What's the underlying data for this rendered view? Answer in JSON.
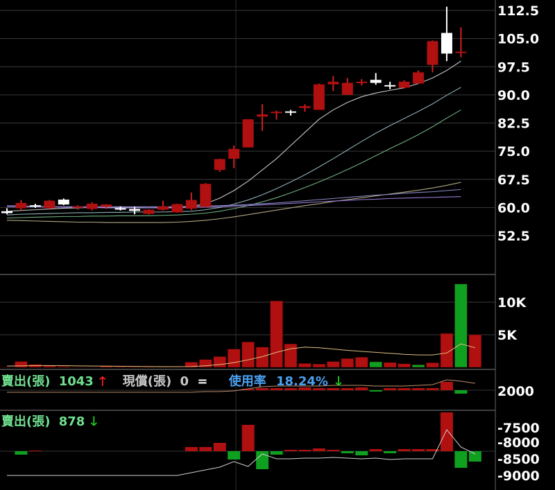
{
  "chart_data": [
    {
      "type": "candlestick",
      "panel": "price",
      "y_ticks": [
        "112.5",
        "105.0",
        "97.5",
        "90.0",
        "82.5",
        "75.0",
        "67.5",
        "60.0",
        "52.5"
      ],
      "ylim": [
        45,
        115
      ],
      "candles": [
        {
          "o": 59.0,
          "h": 59.8,
          "l": 58.2,
          "c": 58.5
        },
        {
          "o": 59.8,
          "h": 62.0,
          "l": 59.2,
          "c": 61.2
        },
        {
          "o": 60.6,
          "h": 61.0,
          "l": 59.9,
          "c": 60.4
        },
        {
          "o": 59.8,
          "h": 62.0,
          "l": 59.6,
          "c": 61.8
        },
        {
          "o": 62.1,
          "h": 62.4,
          "l": 60.6,
          "c": 60.8
        },
        {
          "o": 60.2,
          "h": 60.6,
          "l": 59.4,
          "c": 60.3
        },
        {
          "o": 59.6,
          "h": 61.4,
          "l": 59.2,
          "c": 61.0
        },
        {
          "o": 60.2,
          "h": 60.9,
          "l": 59.6,
          "c": 60.8
        },
        {
          "o": 59.8,
          "h": 60.3,
          "l": 59.2,
          "c": 59.5
        },
        {
          "o": 59.6,
          "h": 60.2,
          "l": 58.2,
          "c": 59.1
        },
        {
          "o": 58.3,
          "h": 59.5,
          "l": 58.1,
          "c": 59.4
        },
        {
          "o": 59.4,
          "h": 61.8,
          "l": 59.2,
          "c": 60.3
        },
        {
          "o": 58.7,
          "h": 61.0,
          "l": 58.6,
          "c": 60.9
        },
        {
          "o": 59.7,
          "h": 64.0,
          "l": 59.3,
          "c": 62.0
        },
        {
          "o": 60.2,
          "h": 66.5,
          "l": 60.0,
          "c": 66.3
        },
        {
          "o": 70.0,
          "h": 73.0,
          "l": 69.5,
          "c": 72.9
        },
        {
          "o": 73.0,
          "h": 76.5,
          "l": 70.5,
          "c": 75.6
        },
        {
          "o": 76.0,
          "h": 83.5,
          "l": 76.0,
          "c": 83.5
        },
        {
          "o": 84.2,
          "h": 87.5,
          "l": 80.4,
          "c": 84.8
        },
        {
          "o": 85.3,
          "h": 85.8,
          "l": 83.4,
          "c": 85.5
        },
        {
          "o": 85.6,
          "h": 86.0,
          "l": 84.5,
          "c": 85.5
        },
        {
          "o": 86.5,
          "h": 87.5,
          "l": 85.5,
          "c": 87.0
        },
        {
          "o": 86.0,
          "h": 93.0,
          "l": 86.0,
          "c": 92.8
        },
        {
          "o": 92.8,
          "h": 95.0,
          "l": 91.0,
          "c": 93.5
        },
        {
          "o": 90.0,
          "h": 94.5,
          "l": 90.0,
          "c": 93.2
        },
        {
          "o": 93.3,
          "h": 94.2,
          "l": 92.5,
          "c": 93.5
        },
        {
          "o": 94.0,
          "h": 95.8,
          "l": 92.7,
          "c": 93.2
        },
        {
          "o": 92.6,
          "h": 93.5,
          "l": 91.5,
          "c": 92.4
        },
        {
          "o": 91.9,
          "h": 93.9,
          "l": 91.7,
          "c": 93.5
        },
        {
          "o": 93.0,
          "h": 96.5,
          "l": 93.0,
          "c": 96.0
        },
        {
          "o": 98.0,
          "h": 104.5,
          "l": 96.0,
          "c": 104.3
        },
        {
          "o": 106.5,
          "h": 113.5,
          "l": 99.0,
          "c": 101.0
        },
        {
          "o": 101.5,
          "h": 108.0,
          "l": 100.0,
          "c": 101.5
        }
      ],
      "moving_averages": [
        {
          "color": "#c8c8c8",
          "values": [
            59.0,
            59.2,
            59.4,
            59.6,
            59.8,
            59.9,
            60.0,
            60.0,
            60.0,
            60.0,
            59.9,
            60.0,
            60.0,
            60.3,
            61.0,
            62.5,
            64.5,
            67.0,
            70.0,
            73.0,
            76.5,
            80.0,
            83.5,
            86.0,
            88.0,
            89.5,
            90.5,
            91.2,
            91.9,
            93.0,
            94.5,
            96.5,
            99.0
          ]
        },
        {
          "color": "#8fb0b8",
          "values": [
            58.0,
            58.2,
            58.3,
            58.4,
            58.5,
            58.6,
            58.6,
            58.7,
            58.7,
            58.8,
            58.8,
            58.8,
            58.9,
            59.0,
            59.4,
            60.0,
            60.9,
            62.0,
            63.4,
            65.0,
            66.8,
            68.7,
            70.8,
            73.0,
            75.3,
            77.6,
            79.8,
            81.8,
            83.7,
            85.6,
            87.6,
            89.9,
            92.0
          ]
        },
        {
          "color": "#70b080",
          "values": [
            57.2,
            57.3,
            57.4,
            57.5,
            57.6,
            57.6,
            57.7,
            57.7,
            57.8,
            57.8,
            57.8,
            57.9,
            58.0,
            58.2,
            58.5,
            59.0,
            59.7,
            60.5,
            61.5,
            62.6,
            63.9,
            65.3,
            66.8,
            68.4,
            70.1,
            71.9,
            73.8,
            75.7,
            77.5,
            79.4,
            81.5,
            83.8,
            86.0
          ]
        },
        {
          "color": "#b0a880",
          "values": [
            56.6,
            56.5,
            56.4,
            56.3,
            56.2,
            56.1,
            56.1,
            56.0,
            56.0,
            56.0,
            56.0,
            56.0,
            56.1,
            56.3,
            56.6,
            57.0,
            57.5,
            58.1,
            58.7,
            59.3,
            59.9,
            60.5,
            61.0,
            61.6,
            62.1,
            62.6,
            63.1,
            63.6,
            64.1,
            64.6,
            65.2,
            65.9,
            66.7
          ]
        },
        {
          "color": "#8a8ac8",
          "values": [
            60.2,
            60.2,
            60.2,
            60.2,
            60.2,
            60.2,
            60.2,
            60.2,
            60.2,
            60.2,
            60.2,
            60.2,
            60.2,
            60.3,
            60.4,
            60.5,
            60.6,
            60.8,
            61.0,
            61.2,
            61.5,
            61.8,
            62.1,
            62.4,
            62.7,
            63.0,
            63.3,
            63.5,
            63.8,
            64.0,
            64.2,
            64.5,
            64.8
          ]
        },
        {
          "color": "#9a7ad8",
          "values": [
            60.5,
            60.4,
            60.3,
            60.2,
            60.1,
            60.0,
            60.0,
            59.9,
            59.9,
            59.9,
            59.9,
            59.9,
            59.9,
            60.0,
            60.1,
            60.2,
            60.4,
            60.5,
            60.7,
            60.9,
            61.1,
            61.3,
            61.5,
            61.7,
            61.9,
            62.1,
            62.2,
            62.4,
            62.5,
            62.6,
            62.7,
            62.8,
            62.9
          ]
        }
      ]
    },
    {
      "type": "bar",
      "panel": "volume",
      "y_ticks": [
        "10K",
        "5K"
      ],
      "ylim": [
        0,
        14000
      ],
      "values": [
        60,
        900,
        450,
        240,
        150,
        60,
        50,
        180,
        100,
        90,
        75,
        60,
        30,
        800,
        1200,
        1650,
        2800,
        3900,
        3100,
        10200,
        3600,
        600,
        500,
        900,
        1350,
        1550,
        850,
        750,
        550,
        400,
        700,
        5200,
        12800,
        5000
      ],
      "colors": [
        "r",
        "r",
        "r",
        "r",
        "r",
        "r",
        "r",
        "r",
        "r",
        "r",
        "r",
        "r",
        "r",
        "r",
        "r",
        "r",
        "r",
        "r",
        "r",
        "r",
        "r",
        "r",
        "r",
        "r",
        "r",
        "r",
        "g",
        "r",
        "r",
        "g",
        "r",
        "r",
        "g",
        "r"
      ],
      "ma": [
        200,
        230,
        260,
        280,
        260,
        230,
        200,
        180,
        160,
        140,
        120,
        110,
        100,
        120,
        240,
        420,
        720,
        1150,
        1640,
        2300,
        2850,
        3100,
        3000,
        2800,
        2600,
        2450,
        2300,
        2150,
        2000,
        1900,
        1900,
        2200,
        3600,
        3000
      ]
    },
    {
      "type": "bar",
      "panel": "indicator",
      "y_ticks": [
        "2000"
      ],
      "values": [
        0,
        0,
        0,
        0,
        0,
        0,
        0,
        0,
        0,
        0,
        0,
        0,
        0,
        0,
        0,
        0,
        0,
        0,
        0,
        0,
        0,
        0,
        0,
        0,
        0,
        0,
        0,
        0,
        0,
        0,
        0,
        0,
        0,
        0
      ],
      "ma": [
        0,
        0,
        0,
        0,
        0,
        0,
        0,
        0,
        0,
        0,
        0,
        0,
        0,
        0,
        0,
        0,
        0,
        0,
        0,
        0,
        0,
        0,
        0,
        0,
        0,
        0,
        0,
        0,
        0,
        0,
        0,
        0,
        0,
        0
      ],
      "legend": [
        {
          "label": "賣出(張)",
          "value": "1043",
          "color": "#70e090",
          "arrow": "up"
        },
        {
          "label": "現償(張)",
          "value": "0",
          "color": "#c8c8c8",
          "arrow": "equal"
        },
        {
          "label": "使用率",
          "value": "18.24%",
          "color": "#4aa0f0",
          "arrow": "down"
        }
      ]
    },
    {
      "type": "bar",
      "panel": "indicator-2",
      "y_ticks": [
        "-7500",
        "-8000",
        "-8500",
        "-9000"
      ],
      "legend": [
        {
          "label": "賣出(張)",
          "value": "878",
          "color": "#70e090",
          "arrow": "down"
        }
      ]
    }
  ],
  "colors": {
    "up": "#b01010",
    "down": "#ffffff",
    "green": "#10a020",
    "axis": "#ffffff",
    "grid": "#3a3a3a"
  }
}
